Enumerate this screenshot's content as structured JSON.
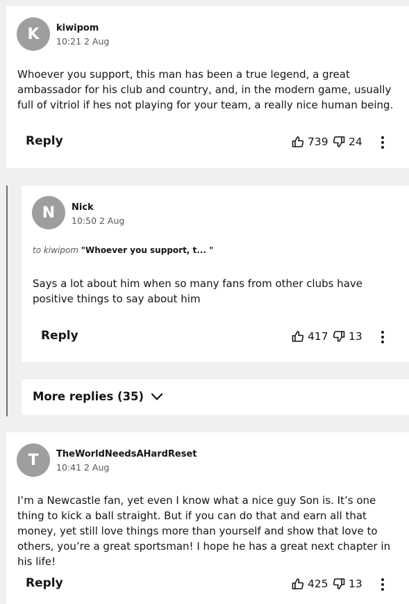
{
  "comments": [
    {
      "avatar_letter": "K",
      "username": "kiwipom",
      "time": "10:21 2 Aug",
      "text": "Whoever you support, this man has been a true legend, a great ambassador for his club and country, and, in the modern game,  usually full of vitriol if hes not playing for your team, a really nice human being.",
      "reply_label": "Reply",
      "upvotes": "739",
      "downvotes": "24"
    },
    {
      "avatar_letter": "N",
      "username": "Nick",
      "time": "10:50 2 Aug",
      "to_prefix": "to kiwipom",
      "to_quote": "\"Whoever you support, t...  \"",
      "text": "Says a lot about him when so many fans from other clubs have positive things to say about him",
      "reply_label": "Reply",
      "upvotes": "417",
      "downvotes": "13"
    },
    {
      "avatar_letter": "T",
      "username": "TheWorldNeedsAHardReset",
      "time": "10:41 2 Aug",
      "text": "I’m a Newcastle fan, yet even I know what a nice guy Son is. It’s one thing to kick a ball straight. But if you can do that and earn all that money, yet still love things more than yourself and show that love to others, you’re a great sportsman! I hope he has a great next chapter in his life!",
      "reply_label": "Reply",
      "upvotes": "425",
      "downvotes": "13"
    }
  ],
  "more_replies_label": "More replies (35)",
  "icons": {
    "upvote": "thumbs-up-icon",
    "downvote": "thumbs-down-icon",
    "more": "more-options-icon",
    "expand": "chevron-down-icon"
  },
  "colors": {
    "background": "#f0f0f0",
    "card": "#ffffff",
    "avatar": "#9e9e9e",
    "text": "#141414",
    "muted": "#545658"
  }
}
